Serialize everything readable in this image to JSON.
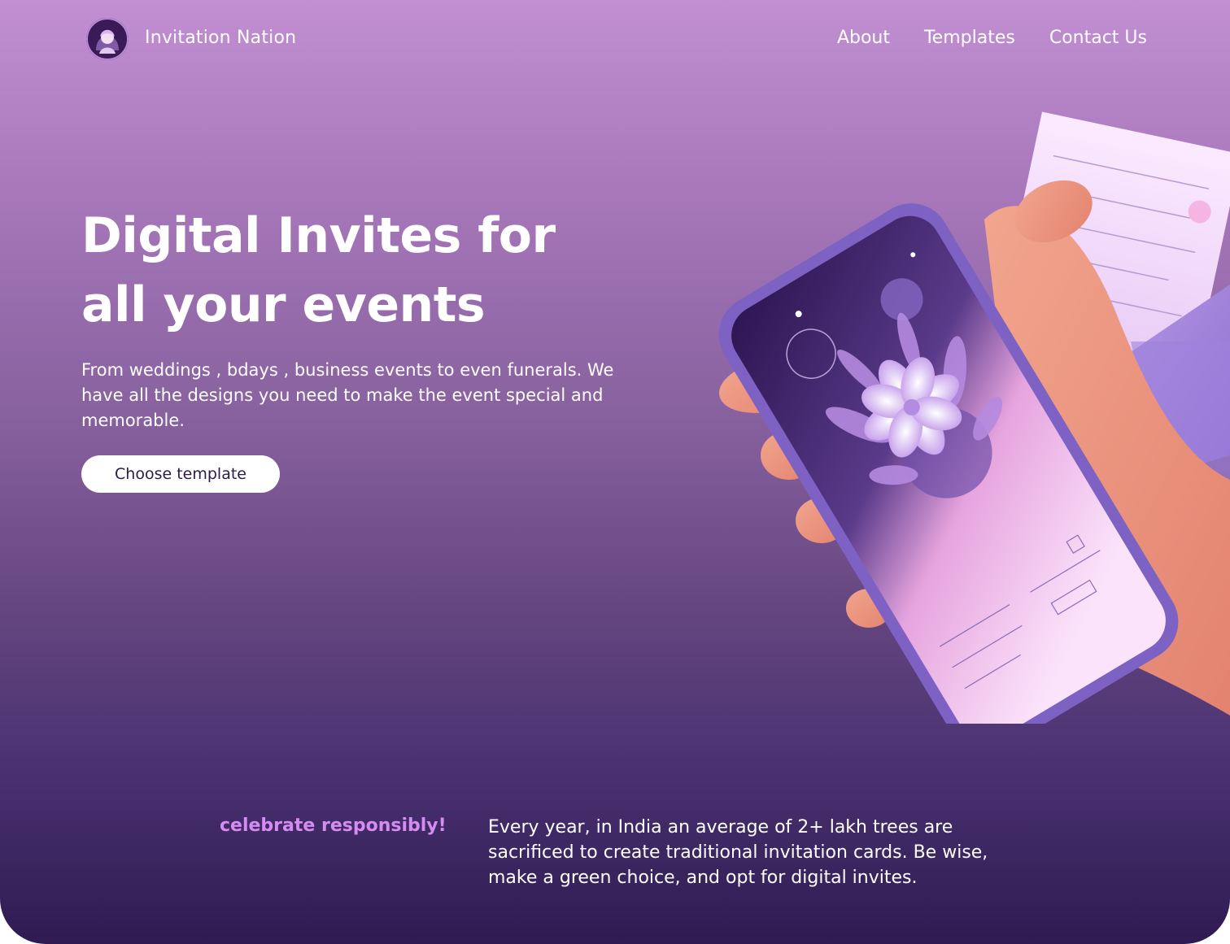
{
  "brand": {
    "name": "Invitation Nation",
    "logo_icon": "avatar-logo-icon"
  },
  "nav": {
    "links": [
      {
        "label": "About"
      },
      {
        "label": "Templates"
      },
      {
        "label": "Contact Us"
      }
    ]
  },
  "hero": {
    "title": "Digital Invites for all your events",
    "description": "From weddings , bdays , business events to even funerals. We have all the designs you need to make the event special and memorable.",
    "cta_label": "Choose template",
    "image_icon": "hand-holding-phone-invitation-illustration"
  },
  "eco": {
    "heading": "celebrate responsibly!",
    "text": "Every year, in India an average of 2+ lakh trees are sacrificed to create traditional invitation cards. Be wise, make a green choice, and opt for digital invites."
  },
  "colors": {
    "gradient_top": "#c18fd2",
    "gradient_bottom": "#2f1b52",
    "accent": "#d58cf0",
    "button_bg": "#ffffff",
    "button_text": "#2d1b47"
  }
}
